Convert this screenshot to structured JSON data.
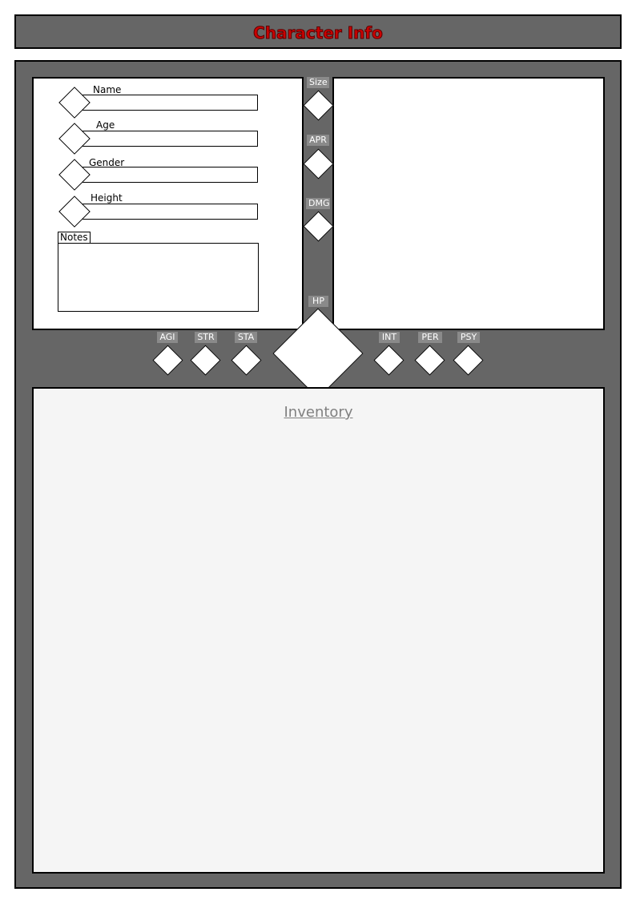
{
  "header": {
    "title": "Character Info"
  },
  "info": {
    "fields": [
      {
        "label": "Name"
      },
      {
        "label": "Age"
      },
      {
        "label": "Gender"
      },
      {
        "label": "Height"
      }
    ],
    "notes_label": "Notes"
  },
  "center_stats": [
    {
      "label": "Size"
    },
    {
      "label": "APR"
    },
    {
      "label": "DMG"
    }
  ],
  "hp": {
    "label": "HP"
  },
  "left_stats": [
    {
      "label": "AGI"
    },
    {
      "label": "STR"
    },
    {
      "label": "STA"
    }
  ],
  "right_stats": [
    {
      "label": "INT"
    },
    {
      "label": "PER"
    },
    {
      "label": "PSY"
    }
  ],
  "inventory": {
    "title": "Inventory"
  },
  "colors": {
    "title_text": "#cc0000",
    "frame": "#666666",
    "stat_label_bg": "#8a8a8a"
  }
}
